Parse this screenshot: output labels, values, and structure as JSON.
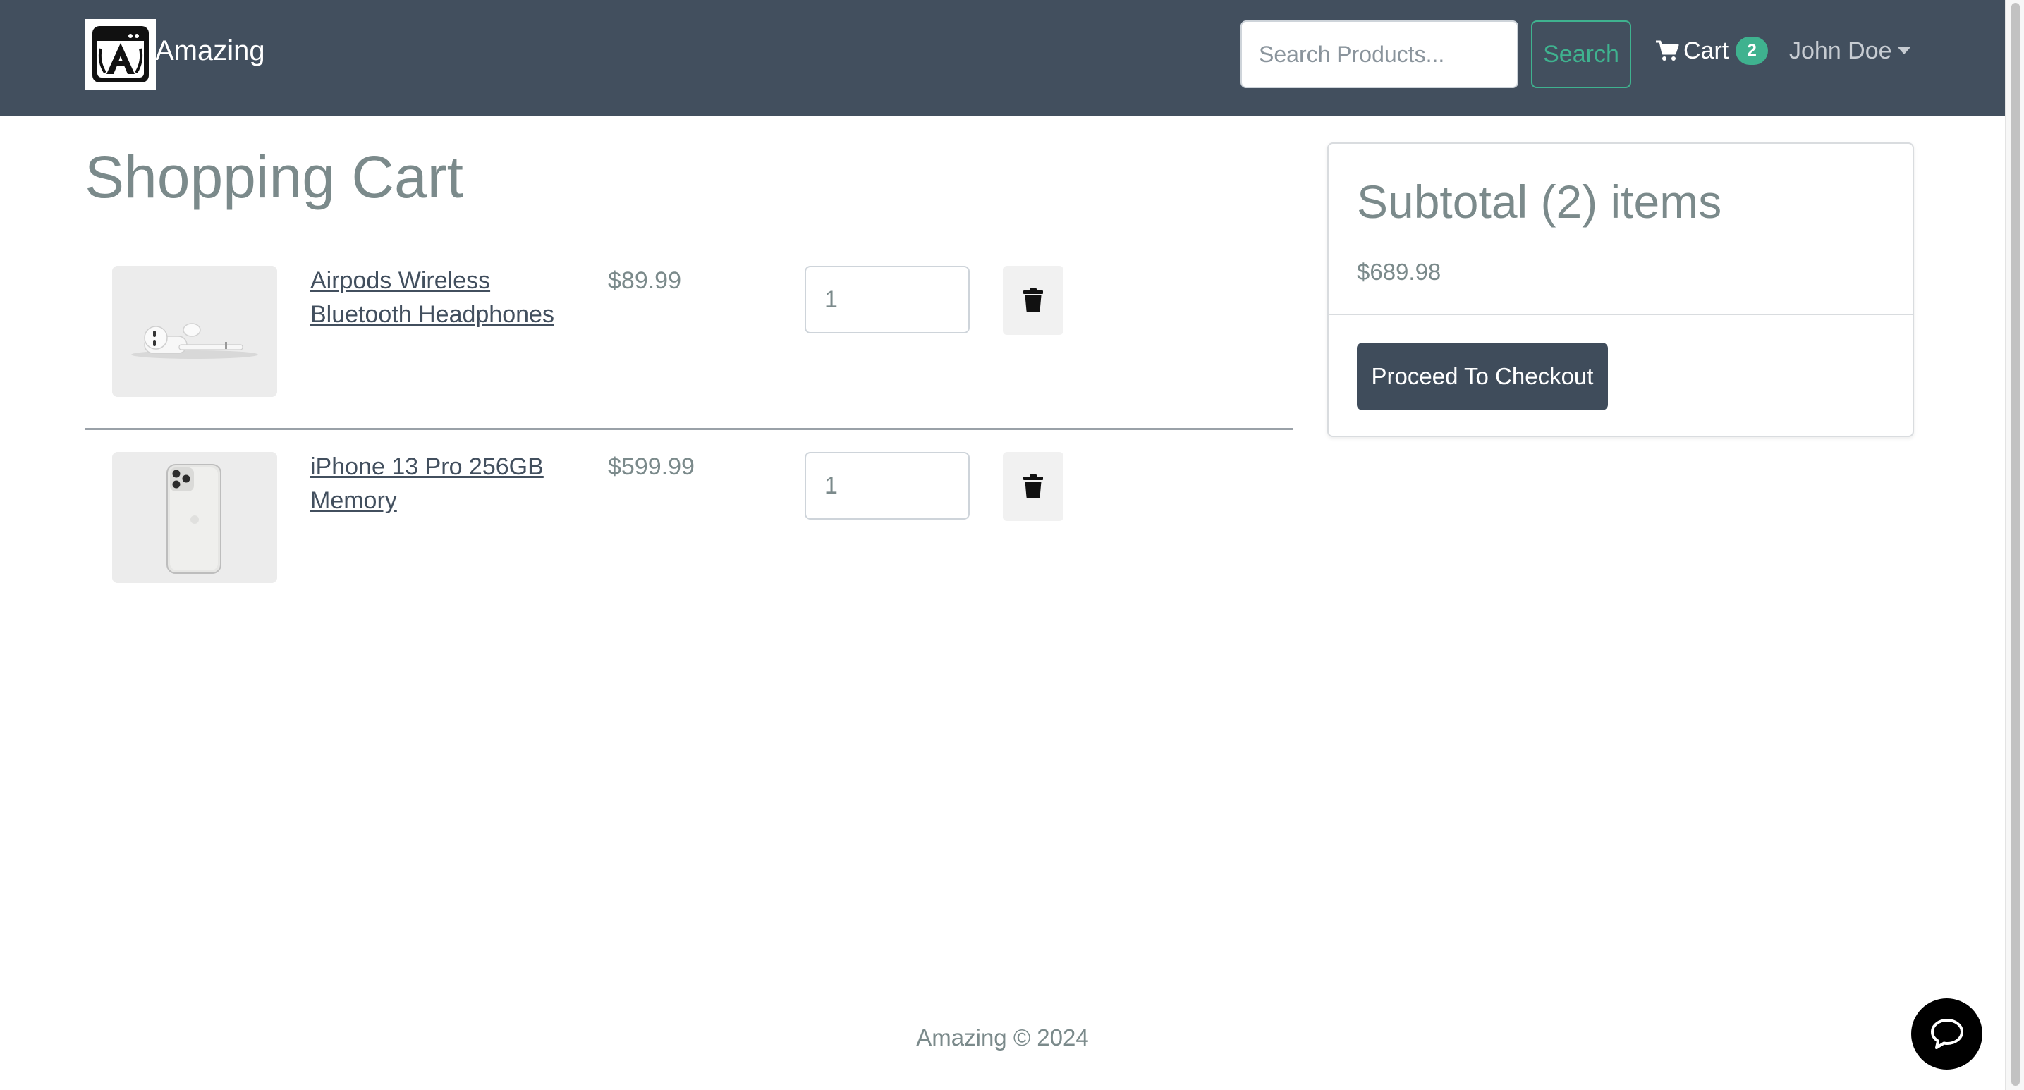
{
  "navbar": {
    "brand_name": "Amazing",
    "search_placeholder": "Search Products...",
    "search_label": "Search",
    "cart_label": "Cart",
    "cart_count": "2",
    "user_name": "John Doe"
  },
  "page": {
    "title": "Shopping Cart"
  },
  "cart": {
    "items": [
      {
        "name": "Airpods Wireless Bluetooth Headphones",
        "price": "$89.99",
        "quantity": "1"
      },
      {
        "name": "iPhone 13 Pro 256GB Memory",
        "price": "$599.99",
        "quantity": "1"
      }
    ]
  },
  "summary": {
    "title": "Subtotal (2) items",
    "total": "$689.98",
    "checkout_label": "Proceed To Checkout"
  },
  "footer": {
    "text": "Amazing © 2024"
  },
  "icons": {
    "logo": "amazing-logo",
    "cart": "shopping-cart-icon",
    "delete": "trash-icon",
    "chat": "chat-bubble-icon"
  },
  "colors": {
    "navbar_bg": "#424f5e",
    "accent": "#3fb28f",
    "checkout_bg": "#3f4c5b",
    "text_muted": "#7b8a8b"
  }
}
